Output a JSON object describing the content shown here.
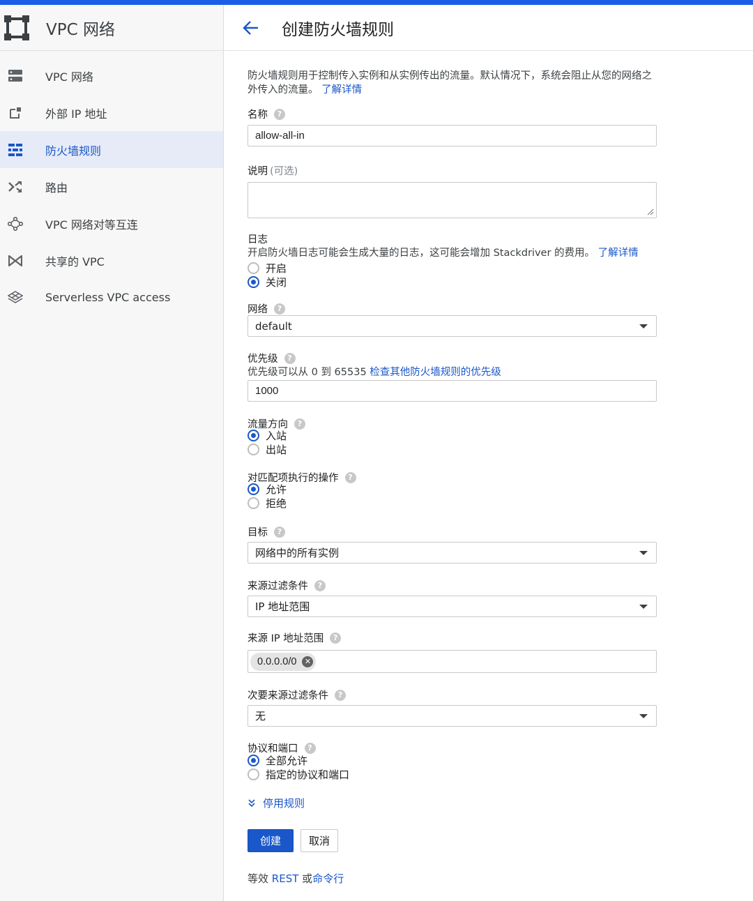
{
  "app": {
    "title": "VPC 网络"
  },
  "sidebar": {
    "items": [
      {
        "label": "VPC 网络",
        "icon": "vpc-network-icon",
        "active": false
      },
      {
        "label": "外部 IP 地址",
        "icon": "external-ip-icon",
        "active": false
      },
      {
        "label": "防火墙规则",
        "icon": "firewall-icon",
        "active": true
      },
      {
        "label": "路由",
        "icon": "routes-icon",
        "active": false
      },
      {
        "label": "VPC 网络对等互连",
        "icon": "peering-icon",
        "active": false
      },
      {
        "label": "共享的 VPC",
        "icon": "shared-vpc-icon",
        "active": false
      },
      {
        "label": "Serverless VPC access",
        "icon": "serverless-icon",
        "active": false
      }
    ]
  },
  "header": {
    "title": "创建防火墙规则"
  },
  "form": {
    "intro_text": "防火墙规则用于控制传入实例和从实例传出的流量。默认情况下，系统会阻止从您的网络之外传入的流量。",
    "intro_link": "了解详情",
    "name": {
      "label": "名称",
      "value": "allow-all-in"
    },
    "description": {
      "label": "说明",
      "optional": "(可选)",
      "value": ""
    },
    "logs": {
      "label": "日志",
      "text": "开启防火墙日志可能会生成大量的日志，这可能会增加 Stackdriver 的费用。",
      "link": "了解详情",
      "options": [
        "开启",
        "关闭"
      ],
      "selected": "关闭"
    },
    "network": {
      "label": "网络",
      "value": "default"
    },
    "priority": {
      "label": "优先级",
      "hint": "优先级可以从 0 到 65535",
      "link": "检查其他防火墙规则的优先级",
      "value": "1000"
    },
    "direction": {
      "label": "流量方向",
      "options": [
        "入站",
        "出站"
      ],
      "selected": "入站"
    },
    "action": {
      "label": "对匹配项执行的操作",
      "options": [
        "允许",
        "拒绝"
      ],
      "selected": "允许"
    },
    "targets": {
      "label": "目标",
      "value": "网络中的所有实例"
    },
    "source_filter": {
      "label": "来源过滤条件",
      "value": "IP 地址范围"
    },
    "source_ranges": {
      "label": "来源 IP 地址范围",
      "chips": [
        "0.0.0.0/0"
      ]
    },
    "second_filter": {
      "label": "次要来源过滤条件",
      "value": "无"
    },
    "protocols": {
      "label": "协议和端口",
      "options": [
        "全部允许",
        "指定的协议和端口"
      ],
      "selected": "全部允许"
    },
    "disable_rule": "停用规则",
    "create_button": "创建",
    "cancel_button": "取消",
    "equivalent": {
      "prefix": "等效",
      "rest": "REST",
      "or": "或",
      "cli": "命令行"
    }
  },
  "colors": {
    "accent": "#1a57c9",
    "topbar": "#1a5ee8",
    "active_bg": "#e6ebf7"
  }
}
